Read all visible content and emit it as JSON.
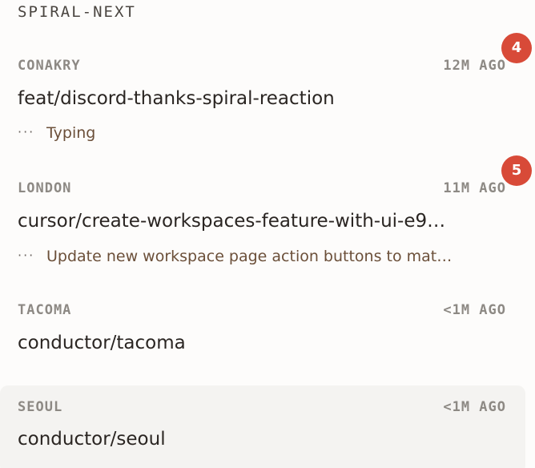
{
  "section": {
    "title": "SPIRAL-NEXT"
  },
  "workspaces": [
    {
      "location": "CONAKRY",
      "time": "12M AGO",
      "branch": "feat/discord-thanks-spiral-reaction",
      "status_icon": "typing-dots-icon",
      "status": "Typing",
      "badge": "4"
    },
    {
      "location": "LONDON",
      "time": "11M AGO",
      "branch": "cursor/create-workspaces-feature-with-ui-e9…",
      "status_icon": "typing-dots-icon",
      "status": "Update new workspace page action buttons to mat…",
      "badge": "5"
    },
    {
      "location": "TACOMA",
      "time": "<1M AGO",
      "branch": "conductor/tacoma"
    },
    {
      "location": "SEOUL",
      "time": "<1M AGO",
      "branch": "conductor/seoul",
      "selected": true
    }
  ],
  "colors": {
    "badge": "#d84a38",
    "selected_bg": "#f4f3f1",
    "status_text": "#6b4f39",
    "meta_text": "#8d8984"
  }
}
